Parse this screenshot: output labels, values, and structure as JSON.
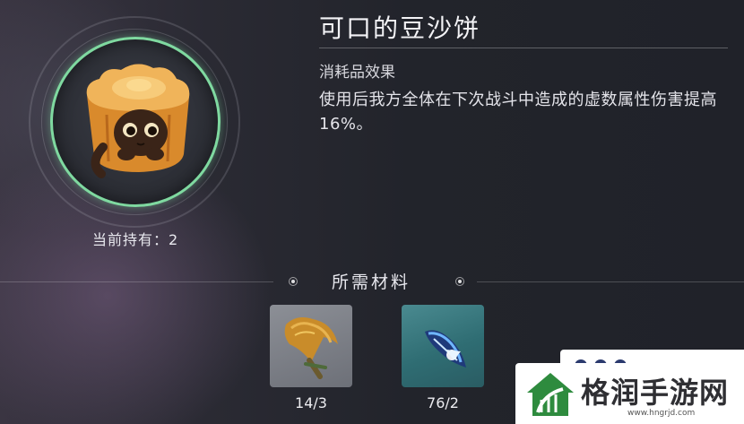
{
  "item": {
    "name": "可口的豆沙饼",
    "held_label": "当前持有：2",
    "ring_color": "#7fd9a0",
    "icon": "mooncake-cat-icon"
  },
  "effect": {
    "label": "消耗品效果",
    "description": "使用后我方全体在下次战斗中造成的虚数属性伤害提高16%。"
  },
  "materials": {
    "title": "所需材料",
    "items": [
      {
        "icon": "wheat-bundle-icon",
        "count": "14/3"
      },
      {
        "icon": "blue-feather-crystal-icon",
        "count": "76/2"
      }
    ]
  },
  "watermark": {
    "name": "格润手游网",
    "url": "www.hngrjd.com",
    "logo_color": "#2e8b3e"
  }
}
